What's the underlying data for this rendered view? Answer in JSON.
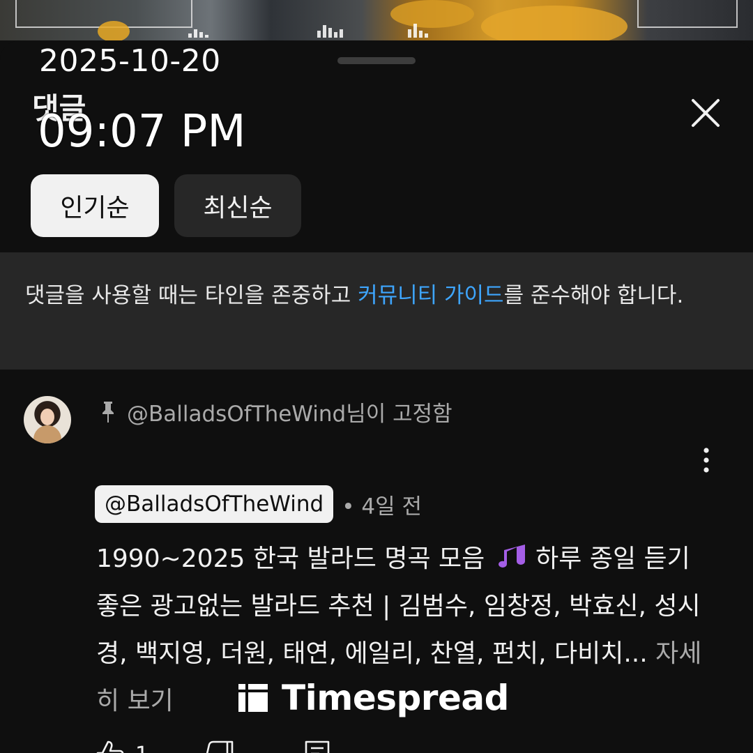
{
  "overlay": {
    "date": "2025-10-20",
    "time": "09:07 PM",
    "watermark": "Timespread"
  },
  "sheet": {
    "title": "댓글",
    "close_icon": "close-icon"
  },
  "sort_chips": [
    {
      "label": "인기순",
      "selected": true
    },
    {
      "label": "최신순",
      "selected": false
    }
  ],
  "notice": {
    "text_before": "댓글을 사용할 때는 타인을 존중하고 ",
    "link": "커뮤니티 가이드",
    "text_after": "를 준수해야 합니다."
  },
  "comment": {
    "pinned_by": "@BalladsOfTheWind님이 고정함",
    "author": "@BalladsOfTheWind",
    "time": "• 4일 전",
    "text_line1_before": "1990~2025 한국 발라드 명곡 모음 ",
    "text_line1_after": " 하루 종일",
    "text_rest": "듣기 좋은 광고없는 발라드 추천 | 김범수, 임창정, 박효신, 성시경, 백지영, 더원, 태연, 에일리, 찬열, 펀치, 다비치...",
    "more_label": " 자세히 보기",
    "like_count": "1"
  },
  "colors": {
    "background": "#0f0f0f",
    "notice_bg": "#272727",
    "link": "#3ea6ff",
    "chip_active": "#f1f1f1",
    "chip_inactive": "#272727"
  }
}
